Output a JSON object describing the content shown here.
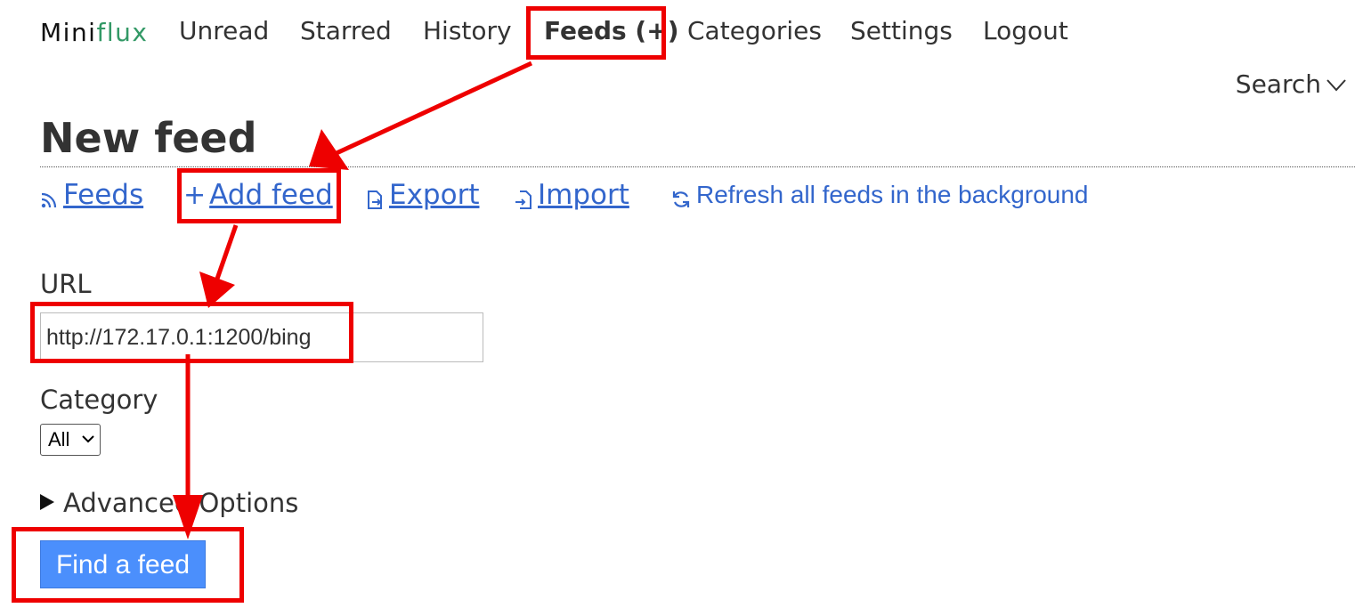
{
  "logo": {
    "part1": "Mini",
    "part2": "flux"
  },
  "nav": {
    "unread": "Unread",
    "starred": "Starred",
    "history": "History",
    "feeds": "Feeds (+)",
    "categories": "Categories",
    "settings": "Settings",
    "logout": "Logout"
  },
  "search": {
    "label": "Search"
  },
  "page": {
    "title": "New feed"
  },
  "sub_menu": {
    "feeds": "Feeds",
    "add_feed": "Add feed",
    "export": "Export",
    "import": "Import",
    "refresh": "Refresh all feeds in the background"
  },
  "form": {
    "url_label": "URL",
    "url_value": "http://172.17.0.1:1200/bing",
    "category_label": "Category",
    "category_selected": "All",
    "advanced_label": "Advanced Options",
    "submit_label": "Find a feed"
  },
  "colors": {
    "link": "#3366cc",
    "accent_green": "#339966",
    "button": "#4b8ffc",
    "annotation_red": "#ee0000"
  },
  "icons": [
    "rss-icon",
    "plus-icon",
    "export-icon",
    "import-icon",
    "refresh-icon",
    "chevron-down-icon",
    "disclosure-triangle-icon"
  ]
}
